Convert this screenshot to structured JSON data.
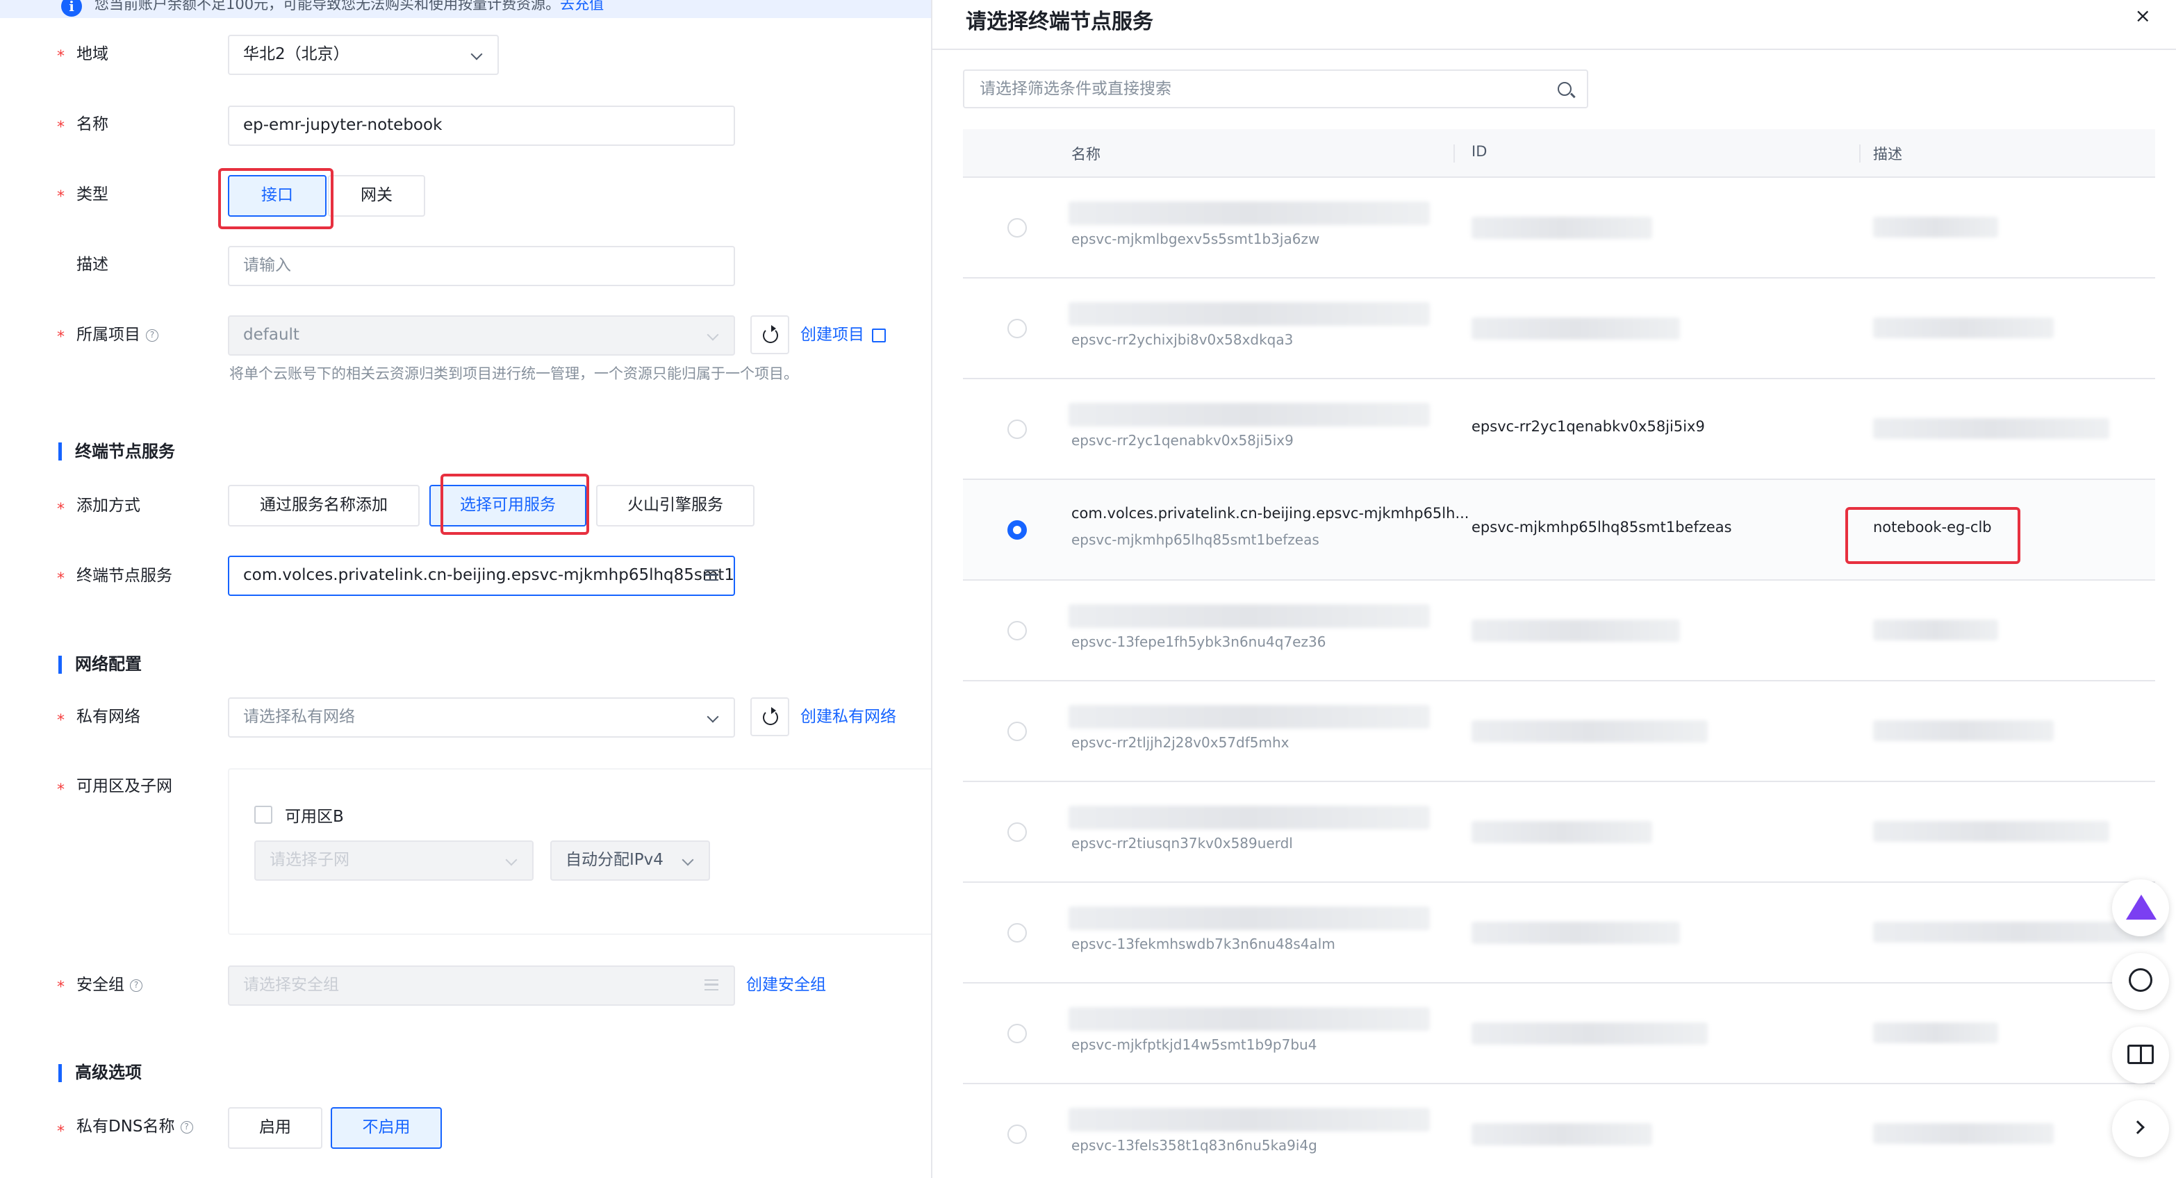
{
  "notice": {
    "text": "您当前账户余额不足100元，可能导致您无法购买和使用按量计费资源。",
    "link": "去充值"
  },
  "form": {
    "region": {
      "label": "地域",
      "value": "华北2（北京）"
    },
    "name": {
      "label": "名称",
      "value": "ep-emr-jupyter-notebook"
    },
    "type": {
      "label": "类型",
      "options": [
        "接口",
        "网关"
      ],
      "selected": "接口"
    },
    "description": {
      "label": "描述",
      "placeholder": "请输入"
    },
    "project": {
      "label": "所属项目",
      "value": "default",
      "create_link": "创建项目",
      "hint": "将单个云账号下的相关云资源归类到项目进行统一管理，一个资源只能归属于一个项目。"
    }
  },
  "endpoint_section": {
    "title": "终端节点服务",
    "add_method": {
      "label": "添加方式",
      "options": [
        "通过服务名称添加",
        "选择可用服务",
        "火山引擎服务"
      ],
      "selected": "选择可用服务"
    },
    "service": {
      "label": "终端节点服务",
      "value": "com.volces.privatelink.cn-beijing.epsvc-mjkmhp65lhq85smt1..."
    }
  },
  "network_section": {
    "title": "网络配置",
    "vpc": {
      "label": "私有网络",
      "placeholder": "请选择私有网络",
      "create_link": "创建私有网络"
    },
    "zone": {
      "label": "可用区及子网",
      "zone_name": "可用区B",
      "subnet_placeholder": "请选择子网",
      "ip_mode": "自动分配IPv4"
    },
    "security_group": {
      "label": "安全组",
      "placeholder": "请选择安全组",
      "create_link": "创建安全组"
    }
  },
  "advanced_section": {
    "title": "高级选项",
    "private_dns": {
      "label": "私有DNS名称",
      "options": [
        "启用",
        "不启用"
      ],
      "selected": "不启用"
    }
  },
  "drawer": {
    "title": "请选择终端节点服务",
    "close": "×",
    "search_placeholder": "请选择筛选条件或直接搜索",
    "columns": [
      "名称",
      "ID",
      "描述"
    ],
    "rows": [
      {
        "sub": "epsvc-mjkmlbgexv5s5smt1b3ja6zw",
        "main": "",
        "id": "",
        "desc": "",
        "selected": false
      },
      {
        "sub": "epsvc-rr2ychixjbi8v0x58xdkqa3",
        "main": "",
        "id": "",
        "desc": "",
        "selected": false
      },
      {
        "sub": "epsvc-rr2yc1qenabkv0x58ji5ix9",
        "main": "",
        "id": "epsvc-rr2yc1qenabkv0x58ji5ix9",
        "desc": "",
        "selected": false
      },
      {
        "sub": "epsvc-mjkmhp65lhq85smt1befzeas",
        "main": "com.volces.privatelink.cn-beijing.epsvc-mjkmhp65lh...",
        "id": "epsvc-mjkmhp65lhq85smt1befzeas",
        "desc": "notebook-eg-clb",
        "selected": true
      },
      {
        "sub": "epsvc-13fepe1fh5ybk3n6nu4q7ez36",
        "main": "",
        "id": "",
        "desc": "",
        "selected": false
      },
      {
        "sub": "epsvc-rr2tljjh2j28v0x57df5mhx",
        "main": "",
        "id": "",
        "desc": "",
        "selected": false
      },
      {
        "sub": "epsvc-rr2tiusqn37kv0x589uerdl",
        "main": "",
        "id": "",
        "desc": "",
        "selected": false
      },
      {
        "sub": "epsvc-13fekmhswdb7k3n6nu48s4alm",
        "main": "",
        "id": "",
        "desc": "",
        "selected": false
      },
      {
        "sub": "epsvc-mjkfptkjd14w5smt1b9p7bu4",
        "main": "",
        "id": "",
        "desc": "",
        "selected": false
      },
      {
        "sub": "epsvc-13fels358t1q83n6nu5ka9i4g",
        "main": "",
        "id": "",
        "desc": "",
        "selected": false
      }
    ]
  },
  "accent_color": "#1664ff",
  "highlight_color": "#e7303f"
}
